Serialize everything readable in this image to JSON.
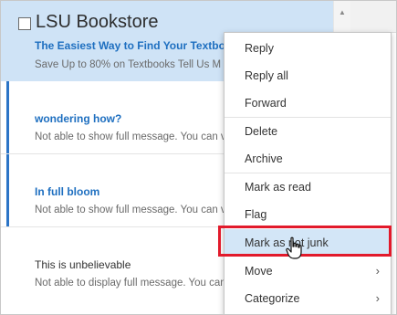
{
  "messages": [
    {
      "sender": "LSU Bookstore",
      "subject": "The Easiest Way to Find Your Textbook",
      "preview": "Save Up to 80% on Textbooks  Tell Us M"
    },
    {
      "subject": "wondering how?",
      "preview": "Not able to show full message. You can vi"
    },
    {
      "subject": "In full bloom",
      "preview": "Not able to show full message. You can vi"
    },
    {
      "subject": "This is unbelievable",
      "preview": "Not able to display full message. You can"
    }
  ],
  "context_menu": {
    "items": [
      {
        "label": "Reply"
      },
      {
        "label": "Reply all"
      },
      {
        "label": "Forward"
      },
      {
        "label": "Delete"
      },
      {
        "label": "Archive"
      },
      {
        "label": "Mark as read"
      },
      {
        "label": "Flag"
      },
      {
        "label": "Mark as not junk"
      },
      {
        "label": "Move",
        "submenu": true
      },
      {
        "label": "Categorize",
        "submenu": true
      }
    ],
    "hovered_item": "Mark as not junk"
  },
  "icons": {
    "checkbox": "checkbox-icon",
    "scroll_up": "scroll-up-arrow-icon",
    "scroll_down": "scroll-down-arrow-icon",
    "submenu": "chevron-right-icon",
    "cursor": "hand-pointer-cursor-icon"
  },
  "colors": {
    "selected_row": "#cfe3f6",
    "accent": "#2b74c6",
    "subject_link": "#1e6fc0",
    "menu_hover": "#d3e6f7",
    "highlight_border": "#e21a2b"
  }
}
